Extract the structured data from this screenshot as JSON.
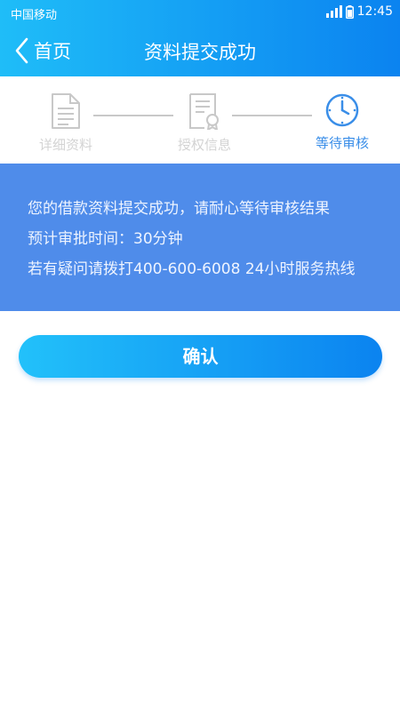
{
  "statusbar": {
    "carrier": "中国移动",
    "time": "12:45",
    "icons": [
      "signal-icon",
      "battery-icon"
    ]
  },
  "navbar": {
    "back_label": "首页",
    "title": "资料提交成功"
  },
  "steps": [
    {
      "label": "详细资料",
      "icon": "document-icon",
      "state": "done"
    },
    {
      "label": "授权信息",
      "icon": "certificate-icon",
      "state": "done"
    },
    {
      "label": "等待审核",
      "icon": "clock-icon",
      "state": "active"
    }
  ],
  "info": {
    "line1": "您的借款资料提交成功，请耐心等待审核结果",
    "line2": "预计审批时间：30分钟",
    "line3": "若有疑问请拨打400-600-6008 24小时服务热线"
  },
  "actions": {
    "confirm_label": "确认"
  },
  "colors": {
    "header_start": "#1fbdf8",
    "header_end": "#0b83f0",
    "panel_bg": "#4f8cea",
    "active_step": "#3a8ee8",
    "inactive_step": "#d3d3d3"
  }
}
